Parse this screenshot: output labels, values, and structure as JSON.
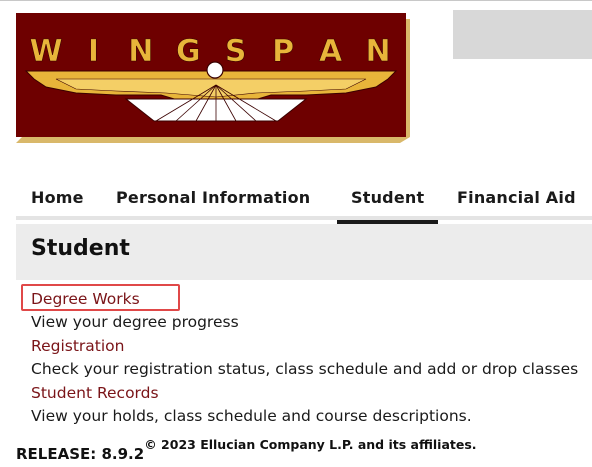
{
  "header": {
    "logo_text": "WINGSPAN",
    "logo_letters": [
      "W",
      "I",
      "N",
      "G",
      "S",
      "P",
      "A",
      "N"
    ]
  },
  "tabs": [
    {
      "label": "Home",
      "active": false
    },
    {
      "label": "Personal Information",
      "active": false
    },
    {
      "label": "Student",
      "active": true
    },
    {
      "label": "Financial Aid",
      "active": false
    }
  ],
  "page": {
    "title": "Student"
  },
  "menu": [
    {
      "link": "Degree Works",
      "description": "View your degree progress",
      "highlighted": true
    },
    {
      "link": "Registration",
      "description": "Check your registration status, class schedule and add or drop classes",
      "highlighted": false
    },
    {
      "link": "Student Records",
      "description": "View your holds, class schedule and course descriptions.",
      "highlighted": false
    }
  ],
  "footer": {
    "release": "RELEASE: 8.9.2",
    "copyright": "© 2023 Ellucian Company L.P. and its affiliates."
  },
  "colors": {
    "logo_maroon": "#6e0000",
    "logo_gold": "#e8b53a",
    "link": "#7a1418",
    "highlight_box": "#e04848"
  }
}
